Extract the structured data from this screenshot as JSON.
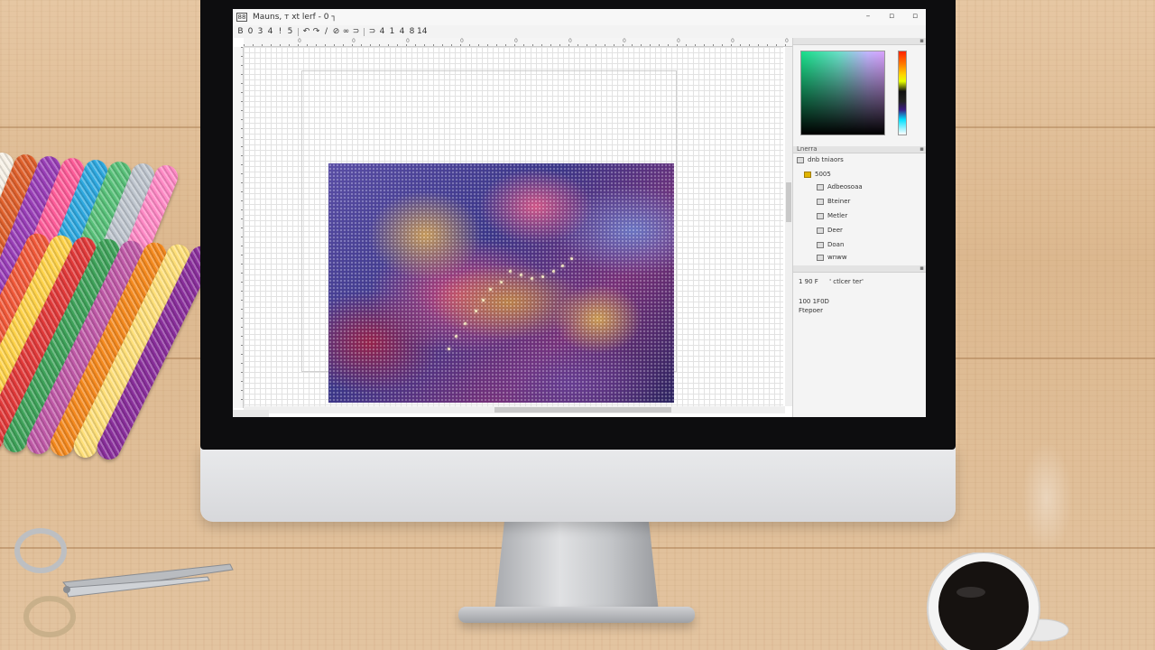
{
  "window": {
    "app_icon": "88",
    "title": "Mauns, т xt lerf - 0 ┐",
    "controls": [
      "–",
      "▫",
      "▫"
    ]
  },
  "toolbar": {
    "tools": [
      "B",
      "0",
      "3",
      "4",
      "!",
      "5",
      "↶",
      "↷",
      "/",
      "⊘",
      "∞",
      "⊃",
      "⊃",
      "4",
      "1",
      "4",
      "8",
      "14"
    ]
  },
  "ruler": {
    "labels": [
      "0",
      "0",
      "0",
      "0",
      "0",
      "0",
      "0",
      "0",
      "0",
      "0"
    ]
  },
  "side_panel": {
    "palette_header": "",
    "layers_header": "Lnerra",
    "layers": [
      {
        "label": "dnb tniaors",
        "icon": "folder-icon"
      },
      {
        "label": "5005",
        "icon": "gold-folder-icon"
      },
      {
        "label": "Adbeosoaa",
        "icon": "layer-icon"
      },
      {
        "label": "Bteiner",
        "icon": "layer-icon"
      },
      {
        "label": "Metler",
        "icon": "layer-icon"
      },
      {
        "label": "Deer",
        "icon": "layer-icon"
      },
      {
        "label": "Doan",
        "icon": "layer-icon"
      },
      {
        "label": "wnww",
        "icon": "layer-icon"
      }
    ],
    "info_lines": [
      "1 90 F",
      "100 1F0D",
      "Ftepoer"
    ],
    "info_extra": "' ctlcer ter'"
  },
  "colors": {
    "desk": "#e2c29e",
    "bezel": "#0d0d0f",
    "chin": "#e2e3e5",
    "thread_colors": [
      "#f7f1e6",
      "#e0612c",
      "#9a3fb8",
      "#ff5d9a",
      "#2fa9e0",
      "#59c27a",
      "#bfc6cf",
      "#ff8ac6",
      "#f25a3a",
      "#ffd34a",
      "#e23a3a",
      "#3fa35a",
      "#c05aa8",
      "#f58a1f",
      "#ffe07a",
      "#8a2f9c"
    ]
  }
}
